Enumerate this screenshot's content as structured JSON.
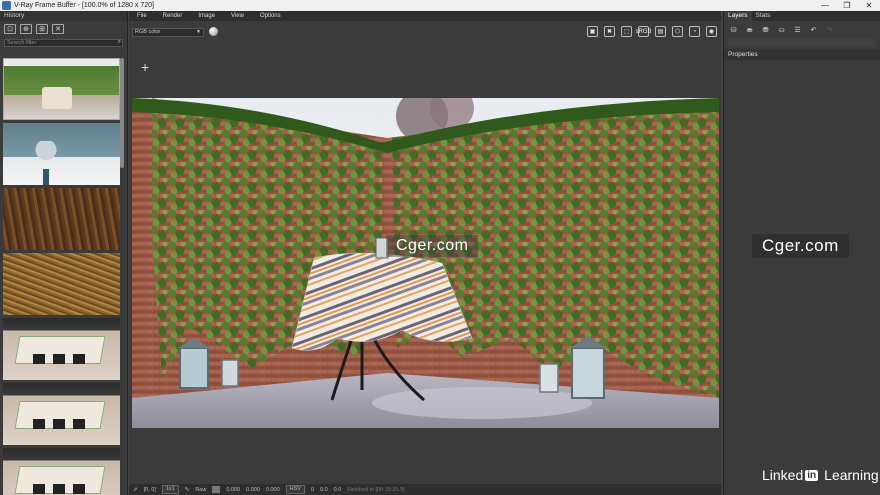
{
  "window": {
    "title": "V-Ray Frame Buffer - [100.0% of 1280 x 720]",
    "controls": [
      "—",
      "❐",
      "✕"
    ]
  },
  "history": {
    "header": "History",
    "search_placeholder": "Search filter",
    "tools": [
      "⊡",
      "⊕",
      "⊞",
      "✕"
    ]
  },
  "menu": [
    "File",
    "Render",
    "Image",
    "View",
    "Options"
  ],
  "toolbar": {
    "channel": "RGB color",
    "icons": [
      "save-icon",
      "clear-icon",
      "region-icon",
      "srgb-icon",
      "lens-icon",
      "stop-icon",
      "render-icon",
      "teapot-icon"
    ],
    "icon_glyphs": [
      "▣",
      "✖",
      "⬚",
      "sRGB",
      "▤",
      "⬡",
      "◔",
      "◉"
    ]
  },
  "status": {
    "coords": "[0, 0]",
    "zoom": "1x1",
    "mode_label": "Raw",
    "values": [
      "0.000",
      "0.000",
      "0.000"
    ],
    "color_space": "HSV",
    "hsv": [
      "0",
      "0.0",
      "0.0"
    ],
    "message": "Finished in [00:15:25.9]"
  },
  "right_panel": {
    "tabs": [
      "Layers",
      "Stats"
    ],
    "tool_glyphs": [
      "⛁",
      "⛂",
      "⛃",
      "⛀",
      "☰",
      "↶",
      "↷"
    ],
    "properties_label": "Properties"
  },
  "watermarks": {
    "cger": "Cger.com",
    "linkedin_prefix": "Linked",
    "linkedin_box": "in",
    "linkedin_suffix": "Learning"
  },
  "colors": {
    "panel_bg": "#3b3b3b",
    "menu_bg": "#2e2e2e",
    "title_bg": "#f0f0f0"
  }
}
